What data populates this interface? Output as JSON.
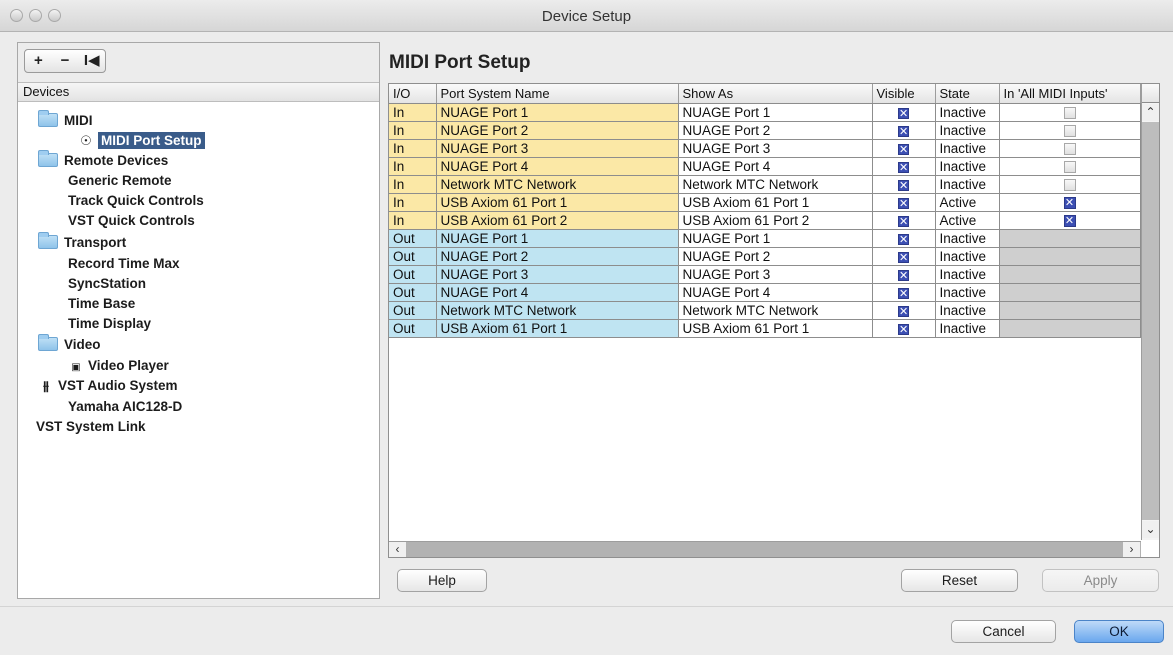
{
  "window": {
    "title": "Device Setup"
  },
  "left_toolbar": {
    "add": "+",
    "remove": "−",
    "reset": "I◀"
  },
  "devices_header": "Devices",
  "tree": [
    {
      "label": "MIDI",
      "kind": "folder"
    },
    {
      "label": "MIDI Port Setup",
      "kind": "midi-port",
      "selected": true
    },
    {
      "label": "Remote Devices",
      "kind": "folder"
    },
    {
      "label": "Generic Remote",
      "kind": "item"
    },
    {
      "label": "Track Quick Controls",
      "kind": "item"
    },
    {
      "label": "VST Quick Controls",
      "kind": "item"
    },
    {
      "label": "Transport",
      "kind": "folder"
    },
    {
      "label": "Record Time Max",
      "kind": "item"
    },
    {
      "label": "SyncStation",
      "kind": "item"
    },
    {
      "label": "Time Base",
      "kind": "item"
    },
    {
      "label": "Time Display",
      "kind": "item"
    },
    {
      "label": "Video",
      "kind": "folder"
    },
    {
      "label": "Video Player",
      "kind": "video"
    },
    {
      "label": "VST Audio System",
      "kind": "audio"
    },
    {
      "label": "Yamaha AIC128-D",
      "kind": "item"
    },
    {
      "label": "VST System Link",
      "kind": "item"
    }
  ],
  "panel_title": "MIDI Port Setup",
  "table": {
    "headers": [
      "I/O",
      "Port System Name",
      "Show As",
      "Visible",
      "State",
      "In 'All MIDI Inputs'"
    ],
    "rows": [
      {
        "io": "In",
        "name": "NUAGE Port 1",
        "show_as": "NUAGE Port 1",
        "visible": true,
        "state": "Inactive",
        "all_inputs": false
      },
      {
        "io": "In",
        "name": "NUAGE Port 2",
        "show_as": "NUAGE Port 2",
        "visible": true,
        "state": "Inactive",
        "all_inputs": false
      },
      {
        "io": "In",
        "name": "NUAGE Port 3",
        "show_as": "NUAGE Port 3",
        "visible": true,
        "state": "Inactive",
        "all_inputs": false
      },
      {
        "io": "In",
        "name": "NUAGE Port 4",
        "show_as": "NUAGE Port 4",
        "visible": true,
        "state": "Inactive",
        "all_inputs": false
      },
      {
        "io": "In",
        "name": "Network MTC Network",
        "show_as": "Network MTC Network",
        "visible": true,
        "state": "Inactive",
        "all_inputs": false
      },
      {
        "io": "In",
        "name": "USB Axiom 61 Port 1",
        "show_as": "USB Axiom 61 Port 1",
        "visible": true,
        "state": "Active",
        "all_inputs": true
      },
      {
        "io": "In",
        "name": "USB Axiom 61 Port 2",
        "show_as": "USB Axiom 61 Port 2",
        "visible": true,
        "state": "Active",
        "all_inputs": true
      },
      {
        "io": "Out",
        "name": "NUAGE Port 1",
        "show_as": "NUAGE Port 1",
        "visible": true,
        "state": "Inactive",
        "all_inputs": null
      },
      {
        "io": "Out",
        "name": "NUAGE Port 2",
        "show_as": "NUAGE Port 2",
        "visible": true,
        "state": "Inactive",
        "all_inputs": null
      },
      {
        "io": "Out",
        "name": "NUAGE Port 3",
        "show_as": "NUAGE Port 3",
        "visible": true,
        "state": "Inactive",
        "all_inputs": null
      },
      {
        "io": "Out",
        "name": "NUAGE Port 4",
        "show_as": "NUAGE Port 4",
        "visible": true,
        "state": "Inactive",
        "all_inputs": null
      },
      {
        "io": "Out",
        "name": "Network MTC Network",
        "show_as": "Network MTC Network",
        "visible": true,
        "state": "Inactive",
        "all_inputs": null
      },
      {
        "io": "Out",
        "name": "USB Axiom 61 Port 1",
        "show_as": "USB Axiom 61 Port 1",
        "visible": true,
        "state": "Inactive",
        "all_inputs": null
      }
    ]
  },
  "buttons": {
    "help": "Help",
    "reset": "Reset",
    "apply": "Apply",
    "cancel": "Cancel",
    "ok": "OK"
  },
  "colors": {
    "in_row": "#fbe8a6",
    "out_row": "#bfe4f2",
    "selection": "#3a5c8a",
    "check": "#3c4fb3"
  }
}
